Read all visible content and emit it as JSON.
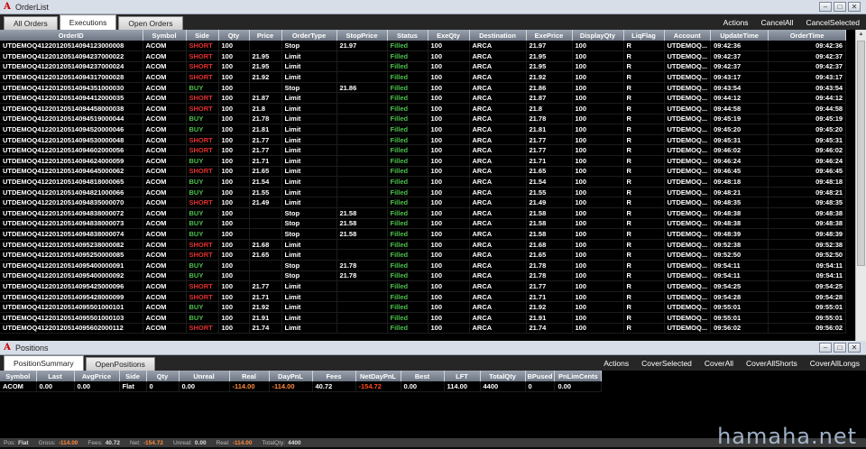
{
  "orders_window": {
    "title": "OrderList",
    "tabs": [
      "All Orders",
      "Executions",
      "Open Orders"
    ],
    "active_tab": 1,
    "actions": [
      "Actions",
      "CancelAll",
      "CancelSelected"
    ],
    "columns": [
      "OrderID",
      "Symbol",
      "Side",
      "Qty",
      "Price",
      "OrderType",
      "StopPrice",
      "Status",
      "ExeQty",
      "Destination",
      "ExePrice",
      "DisplayQty",
      "LiqFlag",
      "Account",
      "UpdateTime",
      "OrderTime"
    ],
    "rows": [
      [
        "UTDEMOQ41220120514094123000008",
        "ACOM",
        "SHORT",
        "100",
        "",
        "Stop",
        "21.97",
        "Filled",
        "100",
        "ARCA",
        "21.97",
        "100",
        "R",
        "UTDEMOQ...",
        "09:42:36",
        "09:42:36"
      ],
      [
        "UTDEMOQ41220120514094237000022",
        "ACOM",
        "SHORT",
        "100",
        "21.95",
        "Limit",
        "",
        "Filled",
        "100",
        "ARCA",
        "21.95",
        "100",
        "R",
        "UTDEMOQ...",
        "09:42:37",
        "09:42:37"
      ],
      [
        "UTDEMOQ41220120514094237000024",
        "ACOM",
        "SHORT",
        "100",
        "21.95",
        "Limit",
        "",
        "Filled",
        "100",
        "ARCA",
        "21.95",
        "100",
        "R",
        "UTDEMOQ...",
        "09:42:37",
        "09:42:37"
      ],
      [
        "UTDEMOQ41220120514094317000028",
        "ACOM",
        "SHORT",
        "100",
        "21.92",
        "Limit",
        "",
        "Filled",
        "100",
        "ARCA",
        "21.92",
        "100",
        "R",
        "UTDEMOQ...",
        "09:43:17",
        "09:43:17"
      ],
      [
        "UTDEMOQ41220120514094351000030",
        "ACOM",
        "BUY",
        "100",
        "",
        "Stop",
        "21.86",
        "Filled",
        "100",
        "ARCA",
        "21.86",
        "100",
        "R",
        "UTDEMOQ...",
        "09:43:54",
        "09:43:54"
      ],
      [
        "UTDEMOQ41220120514094412000035",
        "ACOM",
        "SHORT",
        "100",
        "21.87",
        "Limit",
        "",
        "Filled",
        "100",
        "ARCA",
        "21.87",
        "100",
        "R",
        "UTDEMOQ...",
        "09:44:12",
        "09:44:12"
      ],
      [
        "UTDEMOQ41220120514094458000038",
        "ACOM",
        "SHORT",
        "100",
        "21.8",
        "Limit",
        "",
        "Filled",
        "100",
        "ARCA",
        "21.8",
        "100",
        "R",
        "UTDEMOQ...",
        "09:44:58",
        "09:44:58"
      ],
      [
        "UTDEMOQ41220120514094519000044",
        "ACOM",
        "BUY",
        "100",
        "21.78",
        "Limit",
        "",
        "Filled",
        "100",
        "ARCA",
        "21.78",
        "100",
        "R",
        "UTDEMOQ...",
        "09:45:19",
        "09:45:19"
      ],
      [
        "UTDEMOQ41220120514094520000046",
        "ACOM",
        "BUY",
        "100",
        "21.81",
        "Limit",
        "",
        "Filled",
        "100",
        "ARCA",
        "21.81",
        "100",
        "R",
        "UTDEMOQ...",
        "09:45:20",
        "09:45:20"
      ],
      [
        "UTDEMOQ41220120514094530000048",
        "ACOM",
        "SHORT",
        "100",
        "21.77",
        "Limit",
        "",
        "Filled",
        "100",
        "ARCA",
        "21.77",
        "100",
        "R",
        "UTDEMOQ...",
        "09:45:31",
        "09:45:31"
      ],
      [
        "UTDEMOQ41220120514094602000056",
        "ACOM",
        "SHORT",
        "100",
        "21.77",
        "Limit",
        "",
        "Filled",
        "100",
        "ARCA",
        "21.77",
        "100",
        "R",
        "UTDEMOQ...",
        "09:46:02",
        "09:46:02"
      ],
      [
        "UTDEMOQ41220120514094624000059",
        "ACOM",
        "BUY",
        "100",
        "21.71",
        "Limit",
        "",
        "Filled",
        "100",
        "ARCA",
        "21.71",
        "100",
        "R",
        "UTDEMOQ...",
        "09:46:24",
        "09:46:24"
      ],
      [
        "UTDEMOQ41220120514094645000062",
        "ACOM",
        "SHORT",
        "100",
        "21.65",
        "Limit",
        "",
        "Filled",
        "100",
        "ARCA",
        "21.65",
        "100",
        "R",
        "UTDEMOQ...",
        "09:46:45",
        "09:46:45"
      ],
      [
        "UTDEMOQ41220120514094818000065",
        "ACOM",
        "BUY",
        "100",
        "21.54",
        "Limit",
        "",
        "Filled",
        "100",
        "ARCA",
        "21.54",
        "100",
        "R",
        "UTDEMOQ...",
        "09:48:18",
        "09:48:18"
      ],
      [
        "UTDEMOQ41220120514094821000066",
        "ACOM",
        "BUY",
        "100",
        "21.55",
        "Limit",
        "",
        "Filled",
        "100",
        "ARCA",
        "21.55",
        "100",
        "R",
        "UTDEMOQ...",
        "09:48:21",
        "09:48:21"
      ],
      [
        "UTDEMOQ41220120514094835000070",
        "ACOM",
        "SHORT",
        "100",
        "21.49",
        "Limit",
        "",
        "Filled",
        "100",
        "ARCA",
        "21.49",
        "100",
        "R",
        "UTDEMOQ...",
        "09:48:35",
        "09:48:35"
      ],
      [
        "UTDEMOQ41220120514094838000072",
        "ACOM",
        "BUY",
        "100",
        "",
        "Stop",
        "21.58",
        "Filled",
        "100",
        "ARCA",
        "21.58",
        "100",
        "R",
        "UTDEMOQ...",
        "09:48:38",
        "09:48:38"
      ],
      [
        "UTDEMOQ41220120514094838000073",
        "ACOM",
        "BUY",
        "100",
        "",
        "Stop",
        "21.58",
        "Filled",
        "100",
        "ARCA",
        "21.58",
        "100",
        "R",
        "UTDEMOQ...",
        "09:48:38",
        "09:48:38"
      ],
      [
        "UTDEMOQ41220120514094838000074",
        "ACOM",
        "BUY",
        "100",
        "",
        "Stop",
        "21.58",
        "Filled",
        "100",
        "ARCA",
        "21.58",
        "100",
        "R",
        "UTDEMOQ...",
        "09:48:39",
        "09:48:39"
      ],
      [
        "UTDEMOQ41220120514095238000082",
        "ACOM",
        "SHORT",
        "100",
        "21.68",
        "Limit",
        "",
        "Filled",
        "100",
        "ARCA",
        "21.68",
        "100",
        "R",
        "UTDEMOQ...",
        "09:52:38",
        "09:52:38"
      ],
      [
        "UTDEMOQ41220120514095250000085",
        "ACOM",
        "SHORT",
        "100",
        "21.65",
        "Limit",
        "",
        "Filled",
        "100",
        "ARCA",
        "21.65",
        "100",
        "R",
        "UTDEMOQ...",
        "09:52:50",
        "09:52:50"
      ],
      [
        "UTDEMOQ41220120514095400000091",
        "ACOM",
        "BUY",
        "100",
        "",
        "Stop",
        "21.78",
        "Filled",
        "100",
        "ARCA",
        "21.78",
        "100",
        "R",
        "UTDEMOQ...",
        "09:54:11",
        "09:54:11"
      ],
      [
        "UTDEMOQ41220120514095400000092",
        "ACOM",
        "BUY",
        "100",
        "",
        "Stop",
        "21.78",
        "Filled",
        "100",
        "ARCA",
        "21.78",
        "100",
        "R",
        "UTDEMOQ...",
        "09:54:11",
        "09:54:11"
      ],
      [
        "UTDEMOQ41220120514095425000096",
        "ACOM",
        "SHORT",
        "100",
        "21.77",
        "Limit",
        "",
        "Filled",
        "100",
        "ARCA",
        "21.77",
        "100",
        "R",
        "UTDEMOQ...",
        "09:54:25",
        "09:54:25"
      ],
      [
        "UTDEMOQ41220120514095428000099",
        "ACOM",
        "SHORT",
        "100",
        "21.71",
        "Limit",
        "",
        "Filled",
        "100",
        "ARCA",
        "21.71",
        "100",
        "R",
        "UTDEMOQ...",
        "09:54:28",
        "09:54:28"
      ],
      [
        "UTDEMOQ41220120514095501000101",
        "ACOM",
        "BUY",
        "100",
        "21.92",
        "Limit",
        "",
        "Filled",
        "100",
        "ARCA",
        "21.92",
        "100",
        "R",
        "UTDEMOQ...",
        "09:55:01",
        "09:55:01"
      ],
      [
        "UTDEMOQ41220120514095501000103",
        "ACOM",
        "BUY",
        "100",
        "21.91",
        "Limit",
        "",
        "Filled",
        "100",
        "ARCA",
        "21.91",
        "100",
        "R",
        "UTDEMOQ...",
        "09:55:01",
        "09:55:01"
      ],
      [
        "UTDEMOQ41220120514095602000112",
        "ACOM",
        "SHORT",
        "100",
        "21.74",
        "Limit",
        "",
        "Filled",
        "100",
        "ARCA",
        "21.74",
        "100",
        "R",
        "UTDEMOQ...",
        "09:56:02",
        "09:56:02"
      ]
    ]
  },
  "positions_window": {
    "title": "Positions",
    "tabs": [
      "PositionSummary",
      "OpenPositions"
    ],
    "active_tab": 0,
    "actions": [
      "Actions",
      "CoverSelected",
      "CoverAll",
      "CoverAllShorts",
      "CoverAllLongs"
    ],
    "columns": [
      "Symbol",
      "Last",
      "AvgPrice",
      "Side",
      "Qty",
      "Unreal",
      "Real",
      "DayPnL",
      "Fees",
      "NetDayPnL",
      "Best",
      "LFT",
      "TotalQty",
      "BPused",
      "PnLimCents"
    ],
    "rows": [
      [
        "ACOM",
        "0.00",
        "0.00",
        "Flat",
        "0",
        "0.00",
        "-114.00",
        "-114.00",
        "40.72",
        "-154.72",
        "0.00",
        "114.00",
        "4400",
        "0",
        "0.00"
      ]
    ]
  },
  "statusbar": [
    {
      "label": "Pos:",
      "value": "Flat"
    },
    {
      "label": "Gross:",
      "value": "-114.00"
    },
    {
      "label": "Fees:",
      "value": "40.72"
    },
    {
      "label": "Net:",
      "value": "-154.72"
    },
    {
      "label": "Unreal:",
      "value": "0.00"
    },
    {
      "label": "Real:",
      "value": "-114.00"
    },
    {
      "label": "TotalQty:",
      "value": "4400"
    }
  ],
  "watermark": "hamaha.net",
  "colors": {
    "short": "#e03030",
    "buy": "#4cc04c",
    "filled": "#4cc04c",
    "negative": "#ff4d1a",
    "header": "#7a8390"
  }
}
